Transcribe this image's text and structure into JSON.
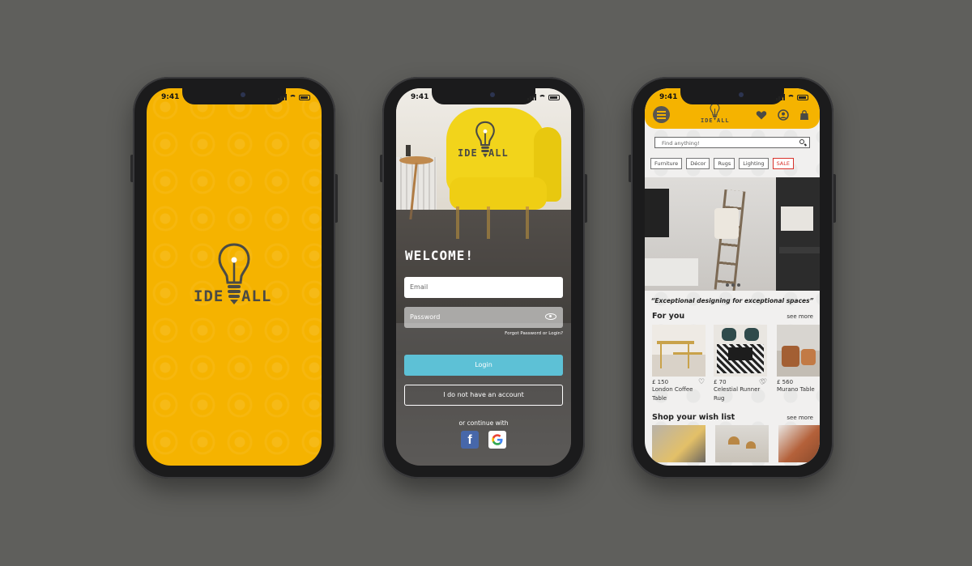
{
  "status_time": "9:41",
  "brand": {
    "left": "IDE",
    "right": "ALL"
  },
  "login": {
    "welcome": "WELCOME!",
    "email_placeholder": "Email",
    "password_placeholder": "Password",
    "forgot": "Forgot Password or Login?",
    "login_label": "Login",
    "no_account_label": "I do not have an account",
    "continue_with": "or continue with",
    "facebook_glyph": "f"
  },
  "home": {
    "search_placeholder": "Find anything!",
    "categories": [
      "Furniture",
      "Décor",
      "Rugs",
      "Lighting",
      "SALE"
    ],
    "tagline": "“Exceptional designing for exceptional spaces”",
    "for_you_title": "For you",
    "see_more": "see more",
    "products": [
      {
        "price": "£ 150",
        "name": "London Coffee Table"
      },
      {
        "price": "£ 70",
        "name": "Celestial Runner Rug"
      },
      {
        "price": "£ 560",
        "name": "Murano Table"
      }
    ],
    "wish_title": "Shop your wish list",
    "icons": [
      "menu-icon",
      "heart-icon",
      "user-icon",
      "bag-icon"
    ]
  },
  "colors": {
    "brand_yellow": "#f5b300",
    "login_button": "#5dc1d6",
    "sale_red": "#d8322b",
    "facebook_blue": "#4767a9",
    "background": "#5f5f5c"
  }
}
